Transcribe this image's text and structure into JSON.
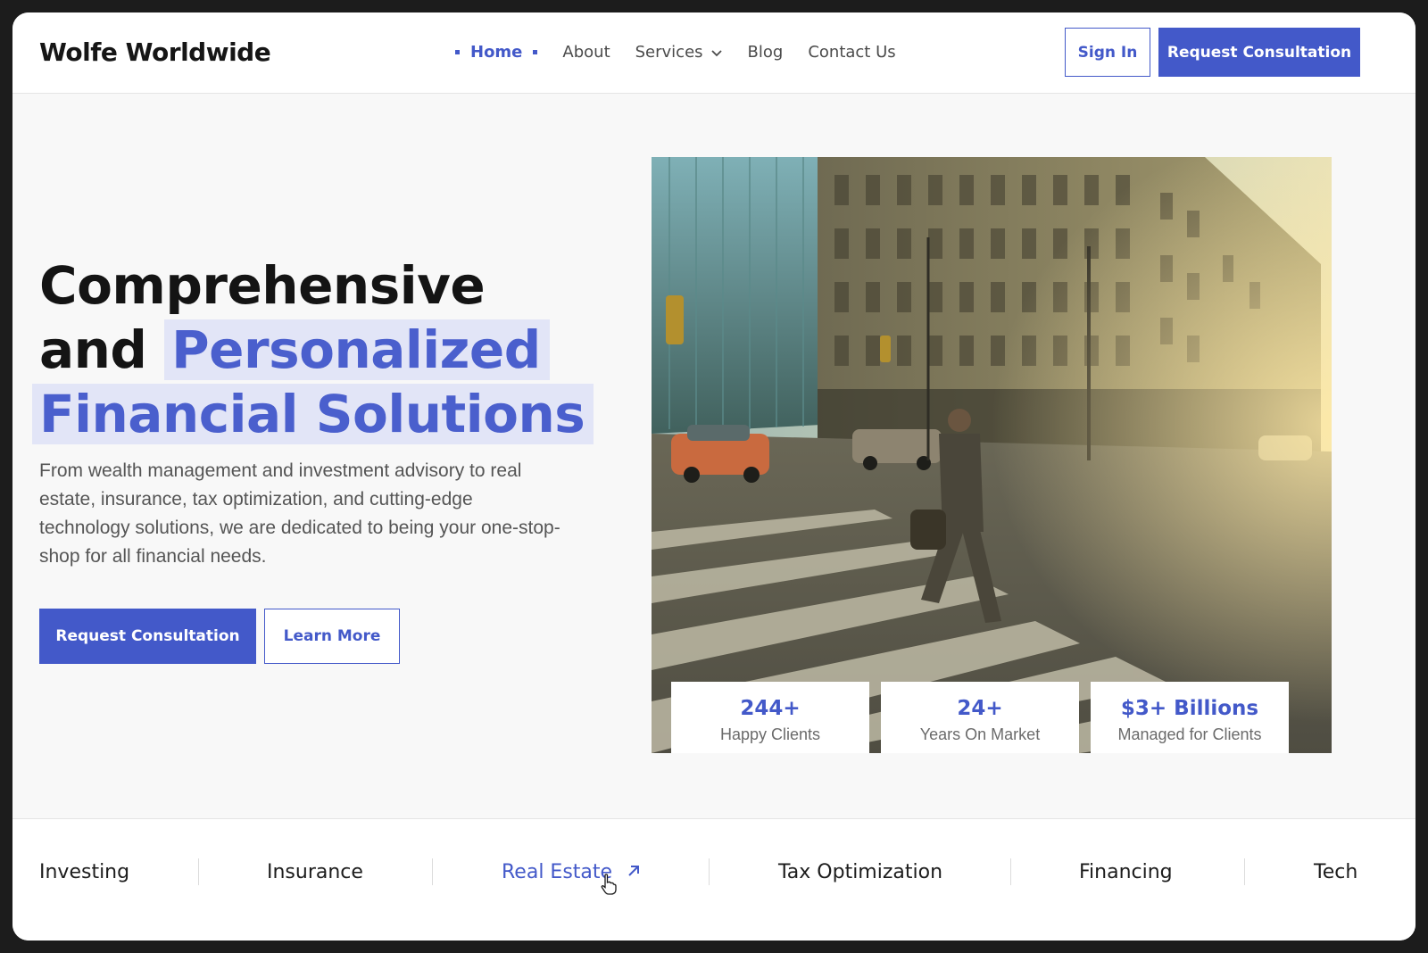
{
  "brand": {
    "name": "Wolfe Worldwide",
    "accent": "#4359c9"
  },
  "nav": {
    "items": [
      {
        "label": "Home",
        "active": true
      },
      {
        "label": "About"
      },
      {
        "label": "Services",
        "has_dropdown": true
      },
      {
        "label": "Blog"
      },
      {
        "label": "Contact Us"
      }
    ],
    "sign_in": "Sign In",
    "request_consultation": "Request Consultation"
  },
  "hero": {
    "title_line1": "Comprehensive",
    "title_and": "and",
    "title_highlight1": "Personalized",
    "title_highlight2": "Financial Solutions",
    "description": "From wealth management and investment advisory to real estate, insurance, tax optimization, and cutting-edge technology solutions, we are dedicated to being your one-stop-shop for all financial needs.",
    "primary_button": "Request Consultation",
    "secondary_button": "Learn More"
  },
  "stats": [
    {
      "value": "244+",
      "label": "Happy Clients"
    },
    {
      "value": "24+",
      "label": "Years On Market"
    },
    {
      "value": "$3+ Billions",
      "label": "Managed for Clients"
    }
  ],
  "categories": [
    {
      "label": "Investing"
    },
    {
      "label": "Insurance"
    },
    {
      "label": "Real Estate",
      "active": true,
      "icon": "arrow-up-right-icon"
    },
    {
      "label": "Tax Optimization"
    },
    {
      "label": "Financing"
    },
    {
      "label": "Tech"
    }
  ]
}
